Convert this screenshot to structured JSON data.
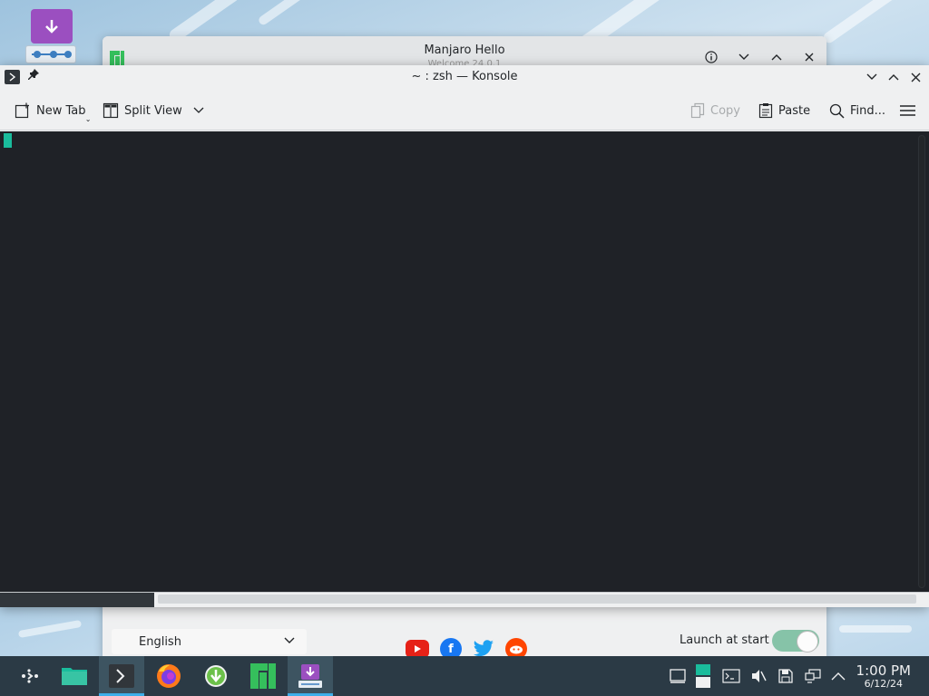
{
  "desktop": {
    "icon_name": "download-installer-icon"
  },
  "hello_window": {
    "title": "Manjaro Hello",
    "subtitle": "Welcome 24.0.1",
    "language": "English",
    "launch_at_start_label": "Launch at start",
    "launch_at_start_enabled": true,
    "socials": [
      "youtube-icon",
      "facebook-icon",
      "twitter-icon",
      "reddit-icon"
    ]
  },
  "konsole": {
    "title": "~ : zsh — Konsole",
    "toolbar": {
      "new_tab": "New Tab",
      "split_view": "Split View",
      "copy": "Copy",
      "paste": "Paste",
      "find": "Find..."
    },
    "terminal_text": ""
  },
  "taskbar": {
    "apps": [
      "application-launcher-icon",
      "file-manager-icon",
      "konsole-icon",
      "firefox-icon",
      "software-update-icon",
      "manjaro-hello-icon",
      "installer-icon"
    ],
    "clock": {
      "time": "1:00 PM",
      "date": "6/12/24"
    }
  },
  "colors": {
    "terminal_bg": "#1f2227",
    "cursor": "#1abc9c",
    "taskbar_bg": "#2b3a45",
    "accent": "#3daee9"
  }
}
